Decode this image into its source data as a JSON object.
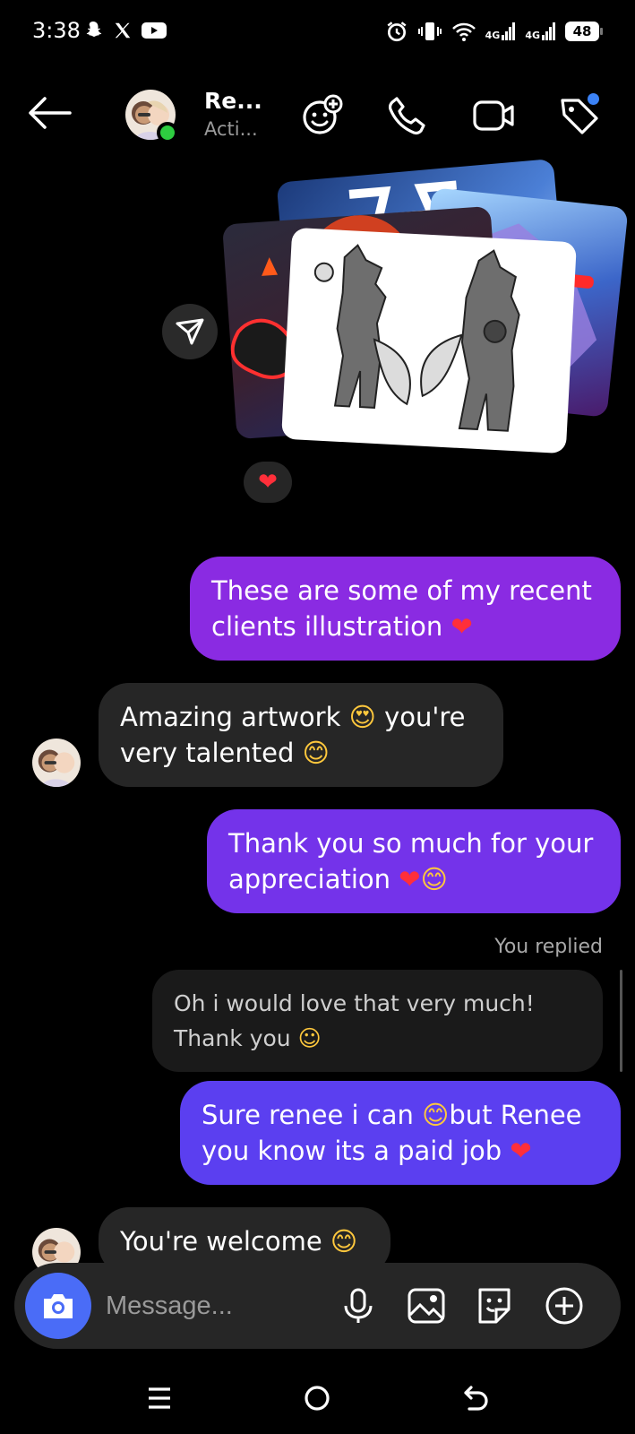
{
  "status_bar": {
    "time": "3:38",
    "left_icons": [
      "snapchat-icon",
      "x-icon",
      "youtube-icon"
    ],
    "right_icons": [
      "alarm-icon",
      "vibrate-icon",
      "wifi-icon",
      "signal-4g-icon",
      "signal-4g-icon"
    ],
    "net1": "4G",
    "net2": "4G",
    "battery": "48"
  },
  "header": {
    "name": "Re...",
    "status": "Acti...",
    "icons": [
      "back-arrow-icon",
      "effects-icon",
      "phone-icon",
      "video-icon",
      "tag-icon"
    ],
    "online_color": "#2ecc40",
    "notification_color": "#3b82f6"
  },
  "media": {
    "reaction": "❤"
  },
  "messages": {
    "m1": {
      "line1": "These are some of my recent",
      "line2": "clients illustration",
      "emoji": "❤"
    },
    "m2": {
      "line1": "Amazing artwork",
      "emoji1": "😍",
      "line1b": "you're",
      "line2": "very talented",
      "emoji2": "😊"
    },
    "m3": {
      "line1": "Thank you so much for your",
      "line2": "appreciation",
      "emoji1": "❤",
      "emoji2": "😊"
    },
    "replied_label": "You replied",
    "quoted": {
      "line1": "Oh i would love that very much!",
      "line2": "Thank you",
      "emoji": "☺"
    },
    "m4": {
      "line1a": "Sure renee i can",
      "emoji1": "😊",
      "line1b": "but Renee",
      "line2": "you know its a paid job",
      "emoji2": "❤"
    },
    "m5": {
      "text": "You're welcome",
      "emoji": "😊"
    }
  },
  "composer": {
    "placeholder": "Message...",
    "icons": [
      "camera-icon",
      "microphone-icon",
      "gallery-icon",
      "sticker-icon",
      "plus-icon"
    ]
  },
  "colors": {
    "outgoing_top": "#8a2be2",
    "outgoing_bottom": "#5b3ff0",
    "incoming": "#262626",
    "camera_button": "#4a6cf7"
  },
  "navbar": {
    "icons": [
      "menu-icon",
      "home-icon",
      "back-icon"
    ]
  }
}
